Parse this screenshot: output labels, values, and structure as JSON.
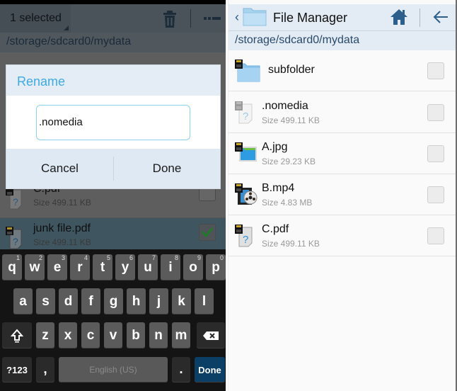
{
  "left_panel": {
    "action_bar": {
      "selection_label": "1 selected",
      "icons": [
        "trash-icon",
        "overflow-menu-icon"
      ]
    },
    "path": "/storage/sdcard0/mydata",
    "list": [
      {
        "name": "C.pdf",
        "size": "Size 499.11 KB",
        "icon": "unknown-file-icon",
        "checked": false
      },
      {
        "name": "junk file.pdf",
        "size": "Size 499.11 KB",
        "icon": "unknown-file-icon",
        "checked": true
      }
    ],
    "dialog": {
      "title": "Rename",
      "input_value": ".nomedia",
      "cancel_label": "Cancel",
      "done_label": "Done"
    },
    "keyboard": {
      "row1": [
        {
          "key": "q",
          "hint": "1"
        },
        {
          "key": "w",
          "hint": "2"
        },
        {
          "key": "e",
          "hint": "3"
        },
        {
          "key": "r",
          "hint": "4"
        },
        {
          "key": "t",
          "hint": "5"
        },
        {
          "key": "y",
          "hint": "6"
        },
        {
          "key": "u",
          "hint": "7"
        },
        {
          "key": "i",
          "hint": "8"
        },
        {
          "key": "o",
          "hint": "9"
        },
        {
          "key": "p",
          "hint": "0"
        }
      ],
      "row2": [
        "a",
        "s",
        "d",
        "f",
        "g",
        "h",
        "j",
        "k",
        "l"
      ],
      "row3": [
        "z",
        "x",
        "c",
        "v",
        "b",
        "n",
        "m"
      ],
      "symbols_label": "?123",
      "comma_label": ",",
      "space_label": "English (US)",
      "period_label": ".",
      "done_label": "Done",
      "shift_icon": "shift-icon",
      "backspace_icon": "backspace-icon"
    }
  },
  "right_panel": {
    "action_bar": {
      "title": "File Manager",
      "icons": [
        "folder-icon",
        "home-icon",
        "back-arrow-icon"
      ]
    },
    "path": "/storage/sdcard0/mydata",
    "list": [
      {
        "name": "subfolder",
        "size": "",
        "icon": "folder-icon",
        "checked": false
      },
      {
        "name": ".nomedia",
        "size": "Size 499.11 KB",
        "icon": "unknown-file-icon",
        "checked": false
      },
      {
        "name": "A.jpg",
        "size": "Size 29.23 KB",
        "icon": "image-file-icon",
        "checked": false
      },
      {
        "name": "B.mp4",
        "size": "Size 4.83 MB",
        "icon": "video-file-icon",
        "checked": false
      },
      {
        "name": "C.pdf",
        "size": "Size 499.11 KB",
        "icon": "unknown-file-icon",
        "checked": false
      }
    ]
  },
  "colors": {
    "dialog_title": "#3fa9e0",
    "checkmark": "#1f7a2a",
    "keyboard_done": "#0b3f66",
    "action_bar_light": "#e3ebf4"
  }
}
